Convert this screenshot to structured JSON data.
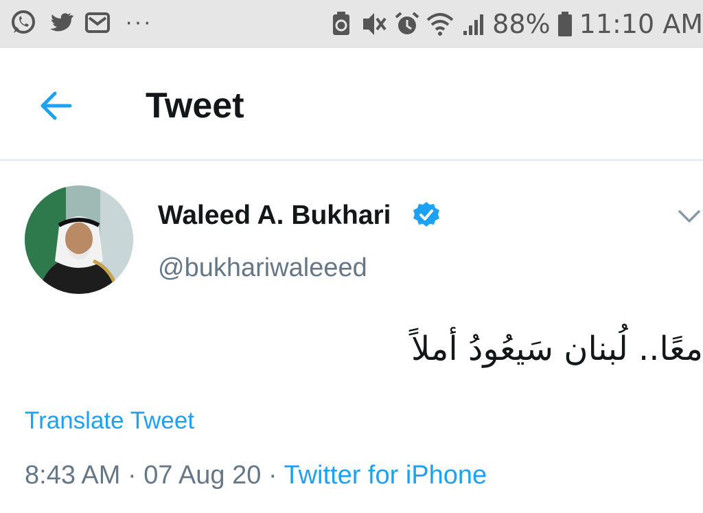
{
  "status_bar": {
    "left_icons": [
      "whatsapp-icon",
      "twitter-icon",
      "mail-icon"
    ],
    "more_indicator": "···",
    "right_icons": [
      "recycle-icon",
      "vibrate-icon",
      "alarm-icon",
      "wifi-icon",
      "signal-icon",
      "battery-icon"
    ],
    "battery": "88%",
    "time": "11:10 AM"
  },
  "header": {
    "back_icon": "arrow-left-icon",
    "title": "Tweet"
  },
  "tweet": {
    "author": {
      "display_name": "Waleed A. Bukhari",
      "handle": "@bukhariwaleeed",
      "verified": true
    },
    "text": "معًا.. لُبنان سَيعُودُ أملاً",
    "translate_label": "Translate Tweet",
    "time": "8:43 AM",
    "separator": "·",
    "date": "07 Aug 20",
    "source": "Twitter for iPhone"
  },
  "colors": {
    "accent": "#1da1f2",
    "text_primary": "#14171a",
    "text_secondary": "#657786",
    "status_bar_bg": "#e6e6e6"
  }
}
